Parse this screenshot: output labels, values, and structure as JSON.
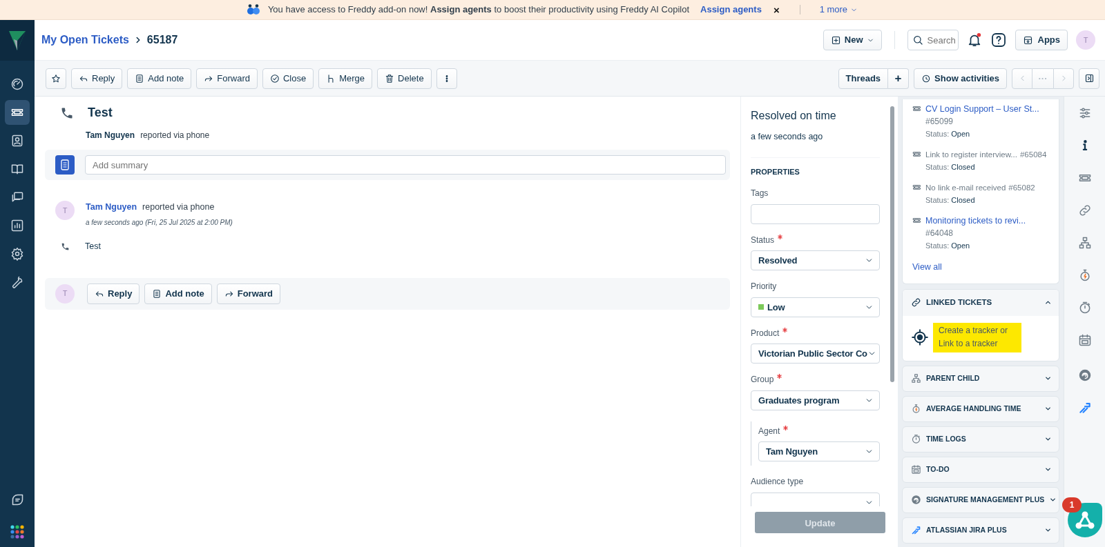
{
  "banner": {
    "message": "You have access to Freddy add-on now! **Assign agents** to boost their productivity using Freddy AI Copilot",
    "link": "Assign agents",
    "close": "×",
    "more": "1 more"
  },
  "sidebar": {
    "items": [
      {
        "selected": false
      },
      {
        "selected": true
      },
      {
        "selected": false
      },
      {
        "selected": false
      },
      {
        "selected": false
      },
      {
        "selected": false
      },
      {
        "selected": false
      },
      {
        "selected": false
      }
    ]
  },
  "header": {
    "breadcrumb": {
      "parent": "My Open Tickets",
      "current": "65187"
    },
    "new_button": "New",
    "search": {
      "placeholder": "Search"
    },
    "notifications": {
      "unread": true
    },
    "apps_button": "Apps",
    "avatar": "T"
  },
  "toolbar": {
    "actions": [
      "Reply",
      "Add note",
      "Forward",
      "Close",
      "Merge",
      "Delete"
    ],
    "threads": "Threads",
    "add": "+",
    "activities": "Show activities",
    "pager": {
      "disabled": true,
      "middle": "···"
    }
  },
  "ticket": {
    "title": "Test",
    "reporter": "Tam Nguyen",
    "via": "reported via phone",
    "summary": {
      "placeholder": "Add summary"
    }
  },
  "conversation": {
    "avatar": "T",
    "author": "Tam Nguyen",
    "via": "reported via phone",
    "time": "a few seconds ago (Fri, 25 Jul 2025 at 2:00 PM)",
    "body": "Test"
  },
  "reply_bar": {
    "avatar": "T",
    "actions": [
      "Reply",
      "Add note",
      "Forward"
    ]
  },
  "properties": {
    "sla_title": "Resolved on time",
    "sla_time": "a few seconds ago",
    "heading": "PROPERTIES",
    "fields": [
      {
        "label": "Tags",
        "required": false,
        "kind": "text"
      },
      {
        "label": "Status",
        "required": true,
        "kind": "select",
        "value": "Resolved"
      },
      {
        "label": "Priority",
        "required": false,
        "kind": "select",
        "value": "Low",
        "color": "#7cc95a"
      },
      {
        "label": "Product",
        "required": true,
        "kind": "select",
        "value": "Victorian Public Sector Co"
      },
      {
        "label": "Group",
        "required": true,
        "kind": "select",
        "value": "Graduates program",
        "children": [
          {
            "label": "Agent",
            "required": true,
            "kind": "select",
            "value": "Tam Nguyen"
          }
        ]
      },
      {
        "label": "Audience type",
        "required": false,
        "kind": "select"
      }
    ],
    "update_button": {
      "label": "Update",
      "disabled": true
    }
  },
  "related": {
    "tickets": [
      {
        "title": "CV Login Support – User St...",
        "number": "#65099",
        "status_label": "Status:",
        "status": "Open",
        "kind": "link"
      },
      {
        "title": "Link to register interview...",
        "number": "#65084",
        "status_label": "Status:",
        "status": "Closed",
        "kind": "plain"
      },
      {
        "title": "No link e-mail received",
        "number": "#65082",
        "status_label": "Status:",
        "status": "Closed",
        "kind": "plain"
      },
      {
        "title": "Monitoring tickets to revi...",
        "number": "#64048",
        "status_label": "Status:",
        "status": "Open",
        "kind": "link"
      }
    ],
    "view_all": "View all"
  },
  "linked_tickets": {
    "title": "LINKED TICKETS",
    "expanded": true,
    "action": "Create a tracker or Link to a tracker",
    "highlighted": true
  },
  "app_sections": [
    {
      "title": "PARENT CHILD",
      "expanded": false
    },
    {
      "title": "AVERAGE HANDLING TIME",
      "expanded": false
    },
    {
      "title": "TIME LOGS",
      "expanded": false
    },
    {
      "title": "TO-DO",
      "expanded": false
    },
    {
      "title": "SIGNATURE MANAGEMENT PLUS",
      "expanded": false
    },
    {
      "title": "ATLASSIAN JIRA PLUS",
      "expanded": false
    }
  ],
  "fab": {
    "badge": "1"
  }
}
